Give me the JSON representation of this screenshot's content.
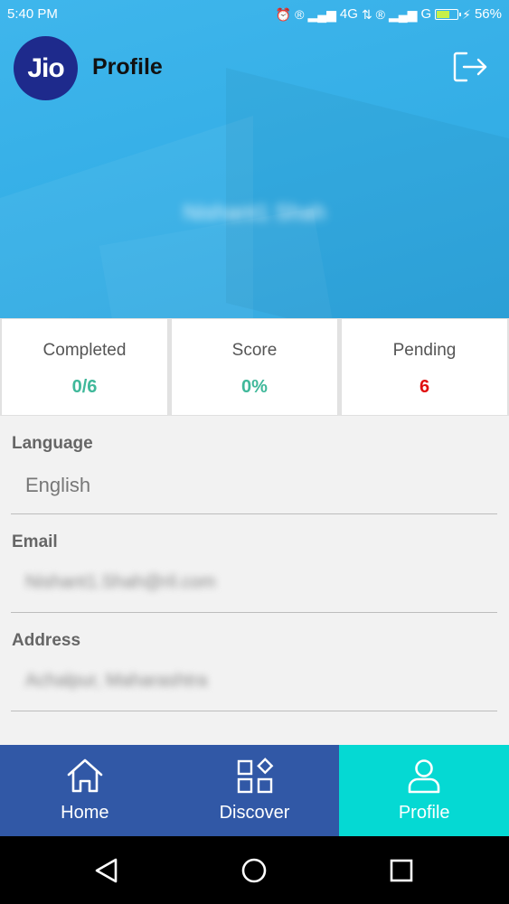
{
  "status_bar": {
    "time": "5:40 PM",
    "network_1": "4G",
    "network_2": "G",
    "battery": "56%",
    "battery_level": 0.56
  },
  "app_bar": {
    "logo_text": "Jio",
    "title": "Profile"
  },
  "profile": {
    "name": "Nishant1 Shah"
  },
  "stats": [
    {
      "label": "Completed",
      "value": "0/6",
      "color": "#3fb89a"
    },
    {
      "label": "Score",
      "value": "0%",
      "color": "#3fb89a"
    },
    {
      "label": "Pending",
      "value": "6",
      "color": "#e01010"
    }
  ],
  "fields": [
    {
      "label": "Language",
      "value": "English"
    },
    {
      "label": "Email",
      "value": "Nishant1.Shah@ril.com"
    },
    {
      "label": "Address",
      "value": "Achalpur, Maharashtra"
    }
  ],
  "bottom_nav": [
    {
      "label": "Home",
      "icon": "home-icon",
      "active": false
    },
    {
      "label": "Discover",
      "icon": "discover-icon",
      "active": false
    },
    {
      "label": "Profile",
      "icon": "profile-icon",
      "active": true
    }
  ],
  "colors": {
    "header_blue": "#34aee6",
    "nav_blue": "#3158a6",
    "nav_active": "#05d9d3",
    "logo_navy": "#1e2a8c"
  }
}
